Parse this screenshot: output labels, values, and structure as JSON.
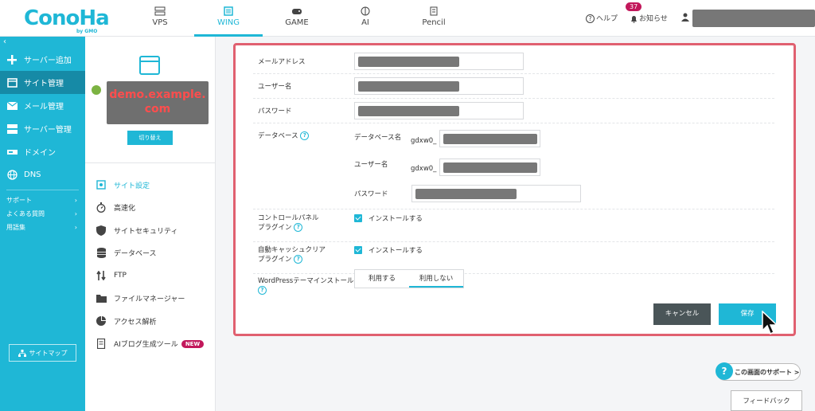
{
  "header": {
    "logo_text": "ConoHa",
    "logo_sub": "by GMO",
    "nav": [
      {
        "label": "VPS",
        "icon": "server-icon"
      },
      {
        "label": "WING",
        "icon": "wing-icon",
        "active": true
      },
      {
        "label": "GAME",
        "icon": "gamepad-icon"
      },
      {
        "label": "AI",
        "icon": "ai-brain-icon"
      },
      {
        "label": "Pencil",
        "icon": "pencil-icon"
      }
    ],
    "help_label": "ヘルプ",
    "notice_label": "お知らせ",
    "notice_count": "37"
  },
  "sidebar": {
    "items": [
      {
        "label": "サーバー追加",
        "icon": "plus-icon"
      },
      {
        "label": "サイト管理",
        "icon": "site-icon",
        "active": true
      },
      {
        "label": "メール管理",
        "icon": "mail-icon"
      },
      {
        "label": "サーバー管理",
        "icon": "server-icon"
      },
      {
        "label": "ドメイン",
        "icon": "domain-icon"
      },
      {
        "label": "DNS",
        "icon": "globe-icon"
      }
    ],
    "links": [
      {
        "label": "サポート"
      },
      {
        "label": "よくある質問"
      },
      {
        "label": "用語集"
      }
    ],
    "sitemap_label": "サイトマップ"
  },
  "site_panel": {
    "site_name_line1": "demo.example.",
    "site_name_line2": "com",
    "switch_label": "切り替え",
    "menu": [
      {
        "label": "サイト設定",
        "icon": "gear-icon",
        "active": true
      },
      {
        "label": "高速化",
        "icon": "stopwatch-icon"
      },
      {
        "label": "サイトセキュリティ",
        "icon": "shield-icon"
      },
      {
        "label": "データベース",
        "icon": "database-icon"
      },
      {
        "label": "FTP",
        "icon": "transfer-icon"
      },
      {
        "label": "ファイルマネージャー",
        "icon": "folder-icon"
      },
      {
        "label": "アクセス解析",
        "icon": "pie-chart-icon"
      },
      {
        "label": "AIブログ生成ツール",
        "icon": "document-icon",
        "badge": "NEW"
      }
    ]
  },
  "form": {
    "email_label": "メールアドレス",
    "username_label": "ユーザー名",
    "password_label": "パスワード",
    "database_label": "データベース",
    "db_name_label": "データベース名",
    "db_user_label": "ユーザー名",
    "db_pass_label": "パスワード",
    "db_prefix": "gdxw0_",
    "cp_plugin_label_1": "コントロールパネル",
    "cp_plugin_label_2": "プラグイン",
    "install_label": "インストールする",
    "cache_plugin_label_1": "自動キャッシュクリア",
    "cache_plugin_label_2": "プラグイン",
    "theme_label": "WordPressテーマインストール",
    "use_label": "利用する",
    "not_use_label": "利用しない",
    "cancel_label": "キャンセル",
    "save_label": "保存"
  },
  "footer": {
    "support_label": "この画面のサポート >",
    "feedback_label": "フィードバック"
  },
  "colors": {
    "accent": "#1fb7d6",
    "sidebar_active": "#168aa6",
    "highlight_border": "#e06070",
    "badge": "#c2185b",
    "cancel_bg": "#4a5558"
  }
}
